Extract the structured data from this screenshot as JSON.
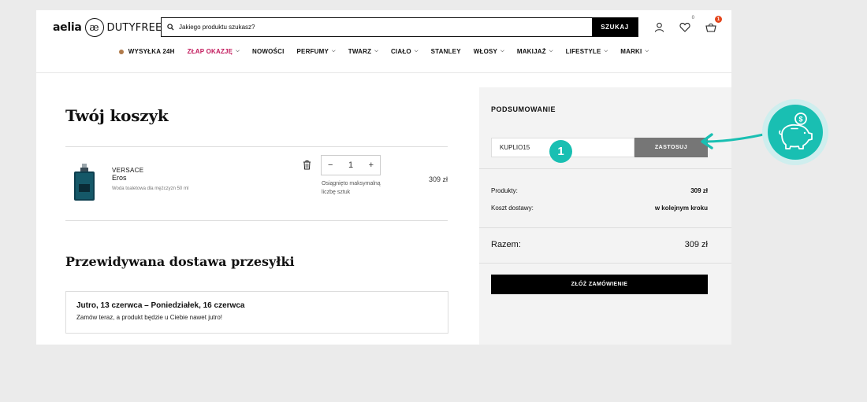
{
  "header": {
    "logo_left": "aelia",
    "logo_mark": "æ",
    "logo_right": "DUTYFREE",
    "search_placeholder": "Jakiego produktu szukasz?",
    "search_button": "SZUKAJ",
    "wishlist_count": "0",
    "cart_count": "1"
  },
  "nav": {
    "items": [
      {
        "label": "WYSYŁKA 24H"
      },
      {
        "label": "ZŁAP OKAZJĘ"
      },
      {
        "label": "NOWOŚCI"
      },
      {
        "label": "PERFUMY"
      },
      {
        "label": "TWARZ"
      },
      {
        "label": "CIAŁO"
      },
      {
        "label": "STANLEY"
      },
      {
        "label": "WŁOSY"
      },
      {
        "label": "MAKIJAŻ"
      },
      {
        "label": "LIFESTYLE"
      },
      {
        "label": "MARKI"
      }
    ]
  },
  "cart": {
    "title": "Twój koszyk",
    "item": {
      "brand": "VERSACE",
      "name": "Eros",
      "description": "Woda toaletowa dla mężczyzn 50 ml",
      "quantity": "1",
      "stock_note": "Osiągnięto maksymalną liczbę sztuk",
      "price": "309 zł"
    }
  },
  "delivery": {
    "title": "Przewidywana dostawa przesyłki",
    "dates": "Jutro, 13 czerwca – Poniedziałek, 16 czerwca",
    "note": "Zamów teraz, a produkt będzie u Ciebie nawet jutro!"
  },
  "summary": {
    "title": "PODSUMOWANIE",
    "coupon_value": "KUPLIO15",
    "apply_button": "ZASTOSUJ",
    "products_label": "Produkty:",
    "products_value": "309 zł",
    "shipping_label": "Koszt dostawy:",
    "shipping_value": "w kolejnym kroku",
    "total_label": "Razem:",
    "total_value": "309 zł",
    "order_button": "ZŁÓŻ ZAMÓWIENIE"
  },
  "overlay": {
    "step_number": "1",
    "piggy_coin_symbol": "$"
  },
  "colors": {
    "accent_teal": "#19bfb2",
    "promo_pink": "#c2185b",
    "cart_badge": "#e4451c"
  }
}
